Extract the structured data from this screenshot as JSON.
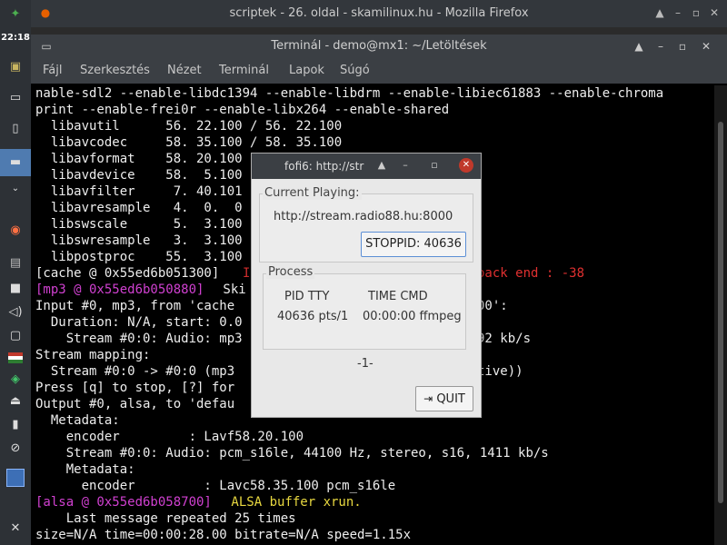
{
  "panel": {
    "clock": "22:18",
    "icons": [
      "app-menu-icon",
      "terminal-icon",
      "device-icon",
      "workspace-icon",
      "collapse-icon",
      "firefox-icon",
      "files-icon",
      "video-icon",
      "volume-icon",
      "display-icon",
      "flag-icon",
      "package-icon",
      "eject-icon",
      "battery-icon",
      "attach-icon",
      "workspace-selected-icon",
      "x-logo-icon"
    ]
  },
  "firefox": {
    "title": "scriptek - 26. oldal - skamilinux.hu - Mozilla Firefox"
  },
  "terminal": {
    "title": "Terminál - demo@mx1: ~/Letöltések",
    "menu": [
      "Fájl",
      "Szerkesztés",
      "Nézet",
      "Terminál",
      "Lapok",
      "Súgó"
    ],
    "lines": [
      "nable-sdl2 --enable-libdc1394 --enable-libdrm --enable-libiec61883 --enable-chroma",
      "print --enable-frei0r --enable-libx264 --enable-shared",
      "  libavutil      56. 22.100 / 56. 22.100",
      "  libavcodec     58. 35.100 / 58. 35.100",
      "  libavformat    58. 20.100",
      "  libavdevice    58.  5.100",
      "  libavfilter     7. 40.101",
      "  libavresample   4.  0.  0",
      "  libswscale      5.  3.100",
      "  libswresample   3.  3.100",
      "  libpostproc    55.  3.100",
      "[cache @ 0x55ed6b051300]",
      "[mp3 @ 0x55ed6b050880]",
      "Input #0, mp3, from 'cache",
      "  Duration: N/A, start: 0.0",
      "    Stream #0:0: Audio: mp3",
      "Stream mapping:",
      "  Stream #0:0 -> #0:0 (mp3",
      "Press [q] to stop, [?] for",
      "Output #0, alsa, to 'defau",
      "  Metadata:",
      "    encoder         : Lavf58.20.100",
      "    Stream #0:0: Audio: pcm_s16le, 44100 Hz, stereo, s16, 1411 kb/s",
      "    Metadata:",
      "      encoder         : Lavc58.35.100 pcm_s16le",
      "[alsa @ 0x55ed6b058700]",
      "    Last message repeated 25 times",
      "size=N/A time=00:00:28.00 bitrate=N/A speed=1.15x"
    ],
    "fragments": {
      "cache_err_start": "I",
      "cache_err_end": "pack end : -38",
      "mp3_tail": " Ski",
      "input_tail": "00':",
      "stream_tail": "92 kb/s",
      "mapping_tail": "tive))",
      "alsa_msg": " ALSA buffer xrun."
    }
  },
  "dialog": {
    "title": "fofi6: http://str",
    "current_label": "Current Playing:",
    "url": "http://stream.radio88.hu:8000",
    "stop_button": "STOPPID: 40636",
    "process_label": "Process",
    "proc_header1": "PID TTY",
    "proc_header2": "TIME CMD",
    "proc_row1": "40636 pts/1",
    "proc_row2": "00:00:00 ffmpeg",
    "status": "-1-",
    "quit_button": "QUIT"
  }
}
